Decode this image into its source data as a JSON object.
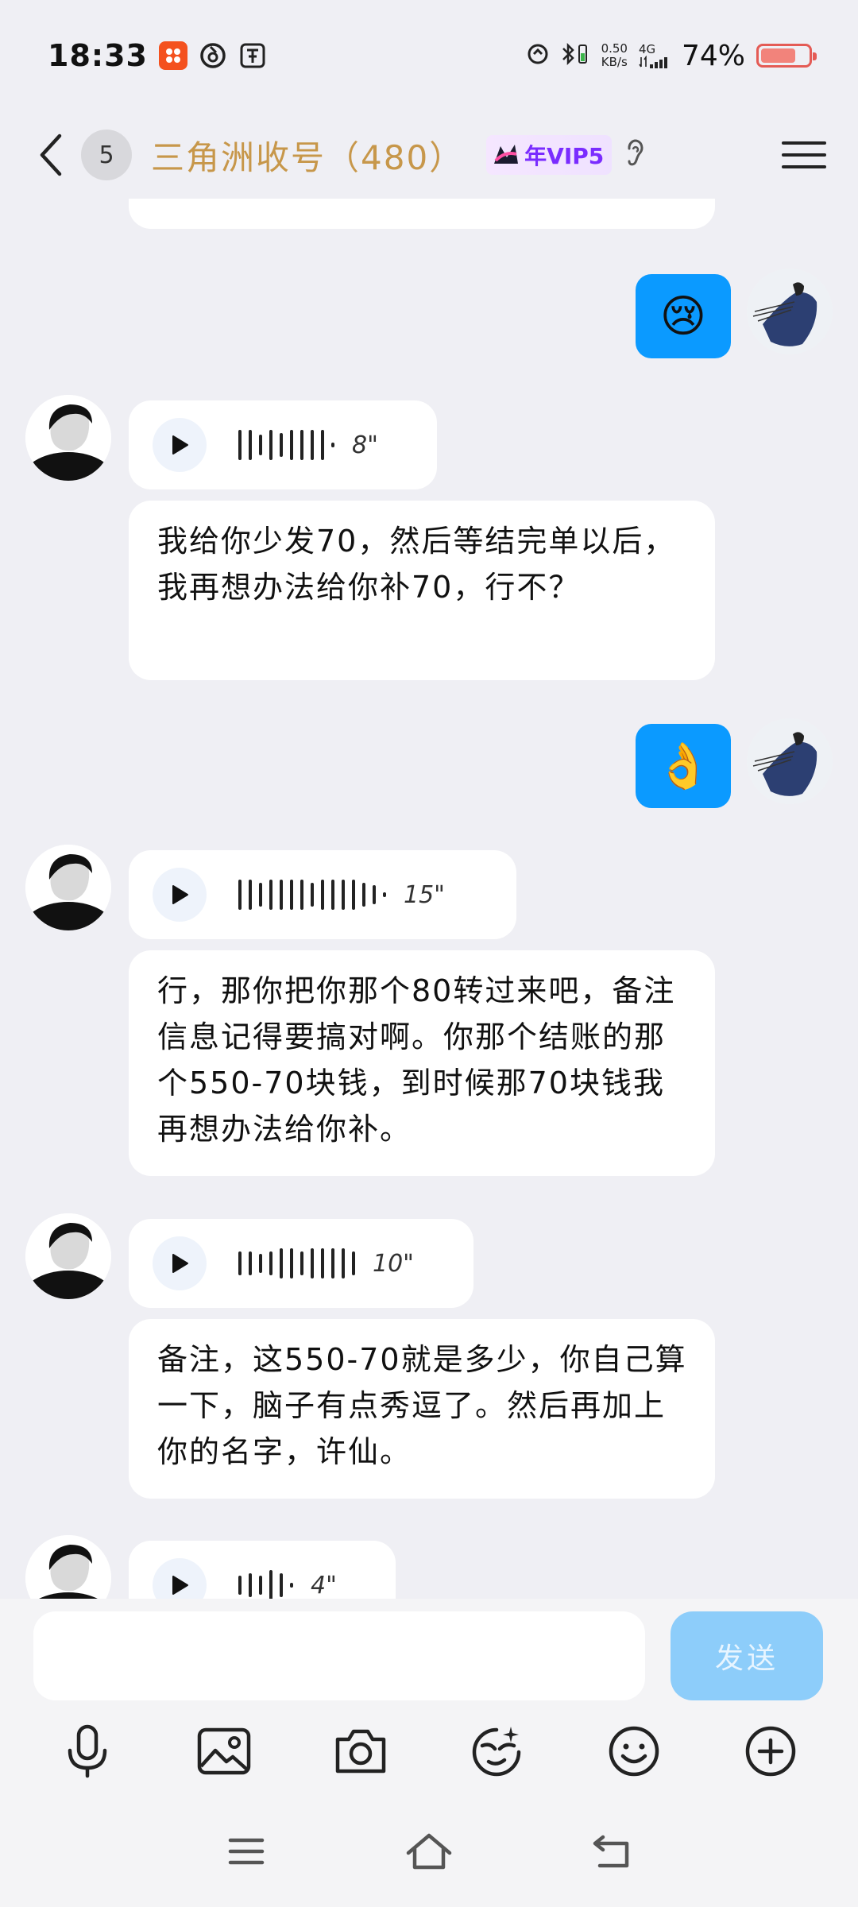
{
  "status_bar": {
    "time": "18:33",
    "net_speed_value": "0.50",
    "net_speed_unit": "KB/s",
    "network_type": "4G",
    "battery_percent": "74%",
    "battery_level": 0.74
  },
  "header": {
    "unread_count": "5",
    "title": "三角洲收号（480）",
    "vip_label": "年VIP5"
  },
  "messages": [
    {
      "side": "right",
      "type": "emoji",
      "content": "😢"
    },
    {
      "side": "left",
      "type": "voice",
      "duration": "8\""
    },
    {
      "side": "left",
      "type": "text",
      "content": "我给你少发70，然后等结完单以后，我再想办法给你补70，行不？"
    },
    {
      "side": "right",
      "type": "emoji",
      "content": "👌"
    },
    {
      "side": "left",
      "type": "voice",
      "duration": "15\""
    },
    {
      "side": "left",
      "type": "text",
      "content": "行，那你把你那个80转过来吧，备注信息记得要搞对啊。你那个结账的那个550-70块钱，到时候那70块钱我再想办法给你补。"
    },
    {
      "side": "left",
      "type": "voice",
      "duration": "10\""
    },
    {
      "side": "left",
      "type": "text",
      "content": "备注，这550-70就是多少，你自己算一下，脑子有点秀逗了。然后再加上你的名字，许仙。"
    },
    {
      "side": "left",
      "type": "voice",
      "duration": "4\""
    }
  ],
  "composer": {
    "input_value": "",
    "send_label": "发送"
  },
  "toolbar_icons": [
    "microphone-icon",
    "image-icon",
    "camera-icon",
    "magic-face-icon",
    "emoji-icon",
    "plus-icon"
  ],
  "colors": {
    "accent_blue": "#0b9aff",
    "title_gold": "#c7974a",
    "vip_purple": "#7a2cff",
    "send_disabled": "#8dcdfa"
  }
}
